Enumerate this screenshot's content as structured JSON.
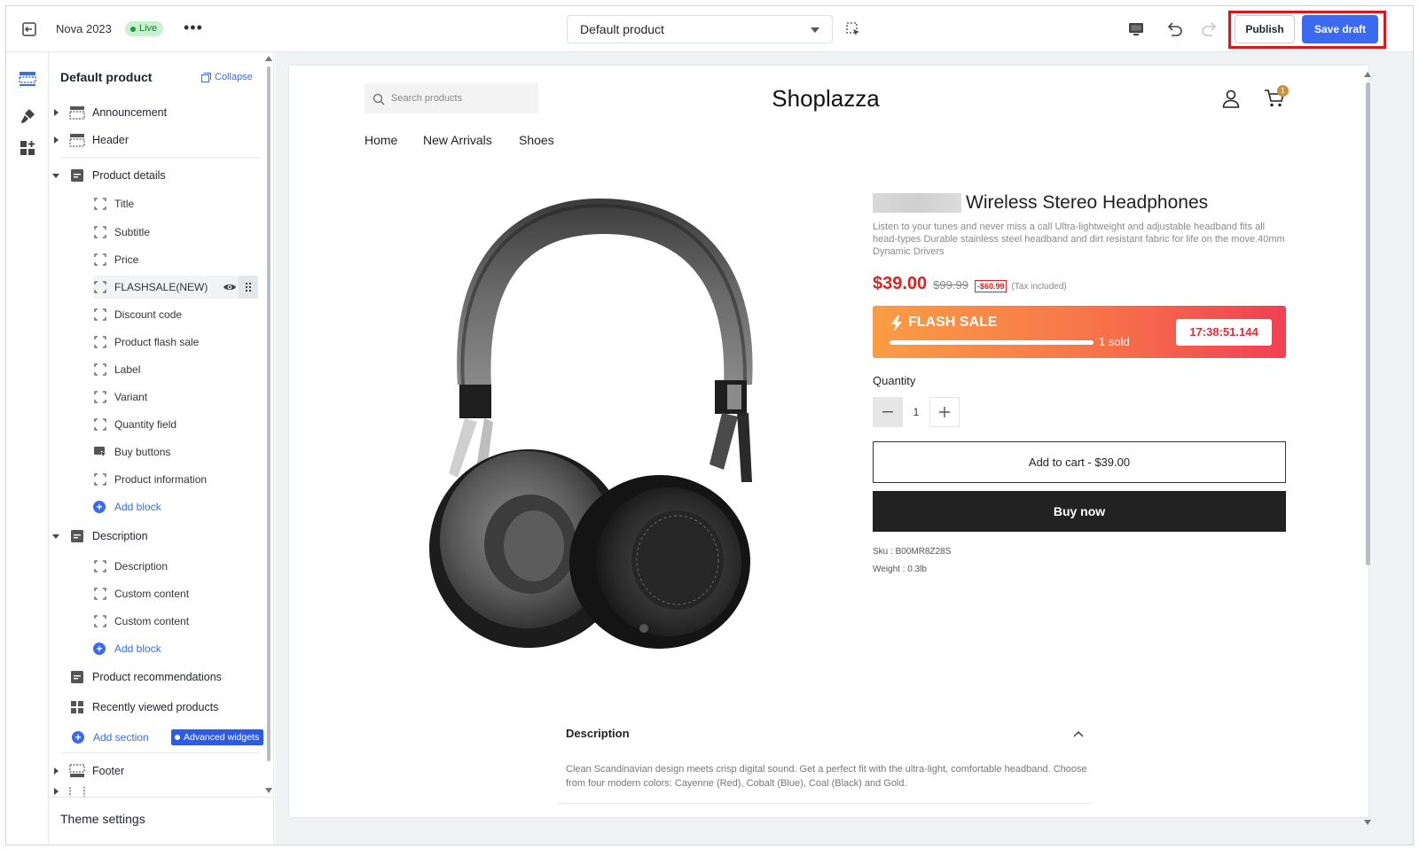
{
  "topbar": {
    "store_name": "Nova 2023",
    "status_badge": "Live",
    "more_label": "•••",
    "template_selected": "Default product",
    "publish_label": "Publish",
    "save_draft_label": "Save draft"
  },
  "colors": {
    "accent": "#3b6af0",
    "live_bg": "#c9f0cf",
    "highlight": "#e0141b",
    "price": "#e02020",
    "flash_from": "#f99d45",
    "flash_to": "#f23f55"
  },
  "rail": {
    "icons": [
      "sections-icon",
      "theme-style-icon",
      "apps-icon"
    ]
  },
  "sidebar": {
    "title": "Default product",
    "collapse_label": "Collapse",
    "announcement": "Announcement",
    "header": "Header",
    "product_details": {
      "label": "Product details",
      "blocks": [
        "Title",
        "Subtitle",
        "Price",
        "FLASHSALE(NEW)",
        "Discount code",
        "Product flash sale",
        "Label",
        "Variant",
        "Quantity field",
        "Buy buttons",
        "Product information"
      ],
      "add_block": "Add block"
    },
    "description": {
      "label": "Description",
      "blocks": [
        "Description",
        "Custom content",
        "Custom content"
      ],
      "add_block": "Add block"
    },
    "product_recommendations": "Product recommendations",
    "recently_viewed": "Recently viewed products",
    "add_section": "Add section",
    "advanced_widgets": "Advanced widgets",
    "footer": "Footer",
    "theme_settings": "Theme settings"
  },
  "store": {
    "search_placeholder": "Search products",
    "logo": "Shoplazza",
    "cart_count": "1",
    "nav": [
      "Home",
      "New Arrivals",
      "Shoes"
    ]
  },
  "product": {
    "title": "Wireless Stereo Headphones",
    "description": "Listen to your tunes and never miss a call Ultra-lightweight and adjustable headband fits all head-types Durable stainless steel headband and dirt resistant fabric for life on the move.40mm Dynamic Drivers",
    "price": "$39.00",
    "compare_price": "$99.99",
    "save_badge": "-$60.99",
    "tax_note": "(Tax included)",
    "flash_sale": {
      "title": "FLASH SALE",
      "sold": "1 sold",
      "timer": "17:38:51.144"
    },
    "quantity_label": "Quantity",
    "quantity_value": "1",
    "add_to_cart": "Add to cart  -  $39.00",
    "buy_now": "Buy now",
    "sku": "Sku : B00MR8Z28S",
    "weight": "Weight : 0.3lb"
  },
  "description_section": {
    "heading": "Description",
    "text": "Clean Scandinavian design meets crisp digital sound. Get a perfect fit with the ultra-light, comfortable headband. Choose from four modern colors: Cayenne (Red), Cobalt (Blue), Coal (Black) and Gold."
  }
}
